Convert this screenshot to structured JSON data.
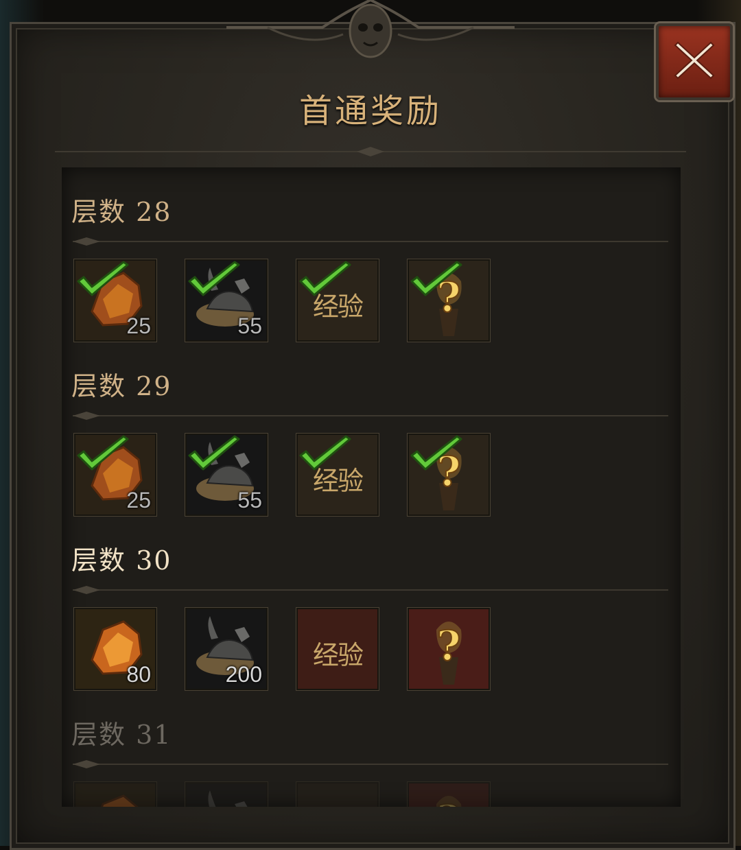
{
  "dialog": {
    "title": "首通奖励",
    "close_icon": "close-x-icon"
  },
  "floors": [
    {
      "label": "层数 28",
      "state": "claimed",
      "rewards": [
        {
          "type": "ore",
          "icon": "amber-ore-icon",
          "qty": "25"
        },
        {
          "type": "armor",
          "icon": "armor-pile-icon",
          "qty": "55"
        },
        {
          "type": "exp",
          "icon": "exp-icon",
          "text": "经验"
        },
        {
          "type": "mystery",
          "icon": "mystery-gear-icon"
        }
      ]
    },
    {
      "label": "层数 29",
      "state": "claimed",
      "rewards": [
        {
          "type": "ore",
          "icon": "amber-ore-icon",
          "qty": "25"
        },
        {
          "type": "armor",
          "icon": "armor-pile-icon",
          "qty": "55"
        },
        {
          "type": "exp",
          "icon": "exp-icon",
          "text": "经验"
        },
        {
          "type": "mystery",
          "icon": "mystery-gear-icon"
        }
      ]
    },
    {
      "label": "层数 30",
      "state": "current",
      "rewards": [
        {
          "type": "ore",
          "icon": "amber-ore-icon",
          "qty": "80"
        },
        {
          "type": "armor",
          "icon": "armor-pile-icon",
          "qty": "200"
        },
        {
          "type": "exp",
          "icon": "exp-icon",
          "text": "经验"
        },
        {
          "type": "mystery",
          "icon": "mystery-gear-icon"
        }
      ]
    },
    {
      "label": "层数 31",
      "state": "locked",
      "rewards": [
        {
          "type": "ore",
          "icon": "amber-ore-icon"
        },
        {
          "type": "armor",
          "icon": "armor-pile-icon"
        },
        {
          "type": "exp",
          "icon": "exp-icon"
        },
        {
          "type": "mystery",
          "icon": "mystery-gear-icon"
        }
      ]
    }
  ],
  "colors": {
    "title": "#d8b27a",
    "check": "#5fc43a",
    "close_button": "#8a2b1a"
  }
}
